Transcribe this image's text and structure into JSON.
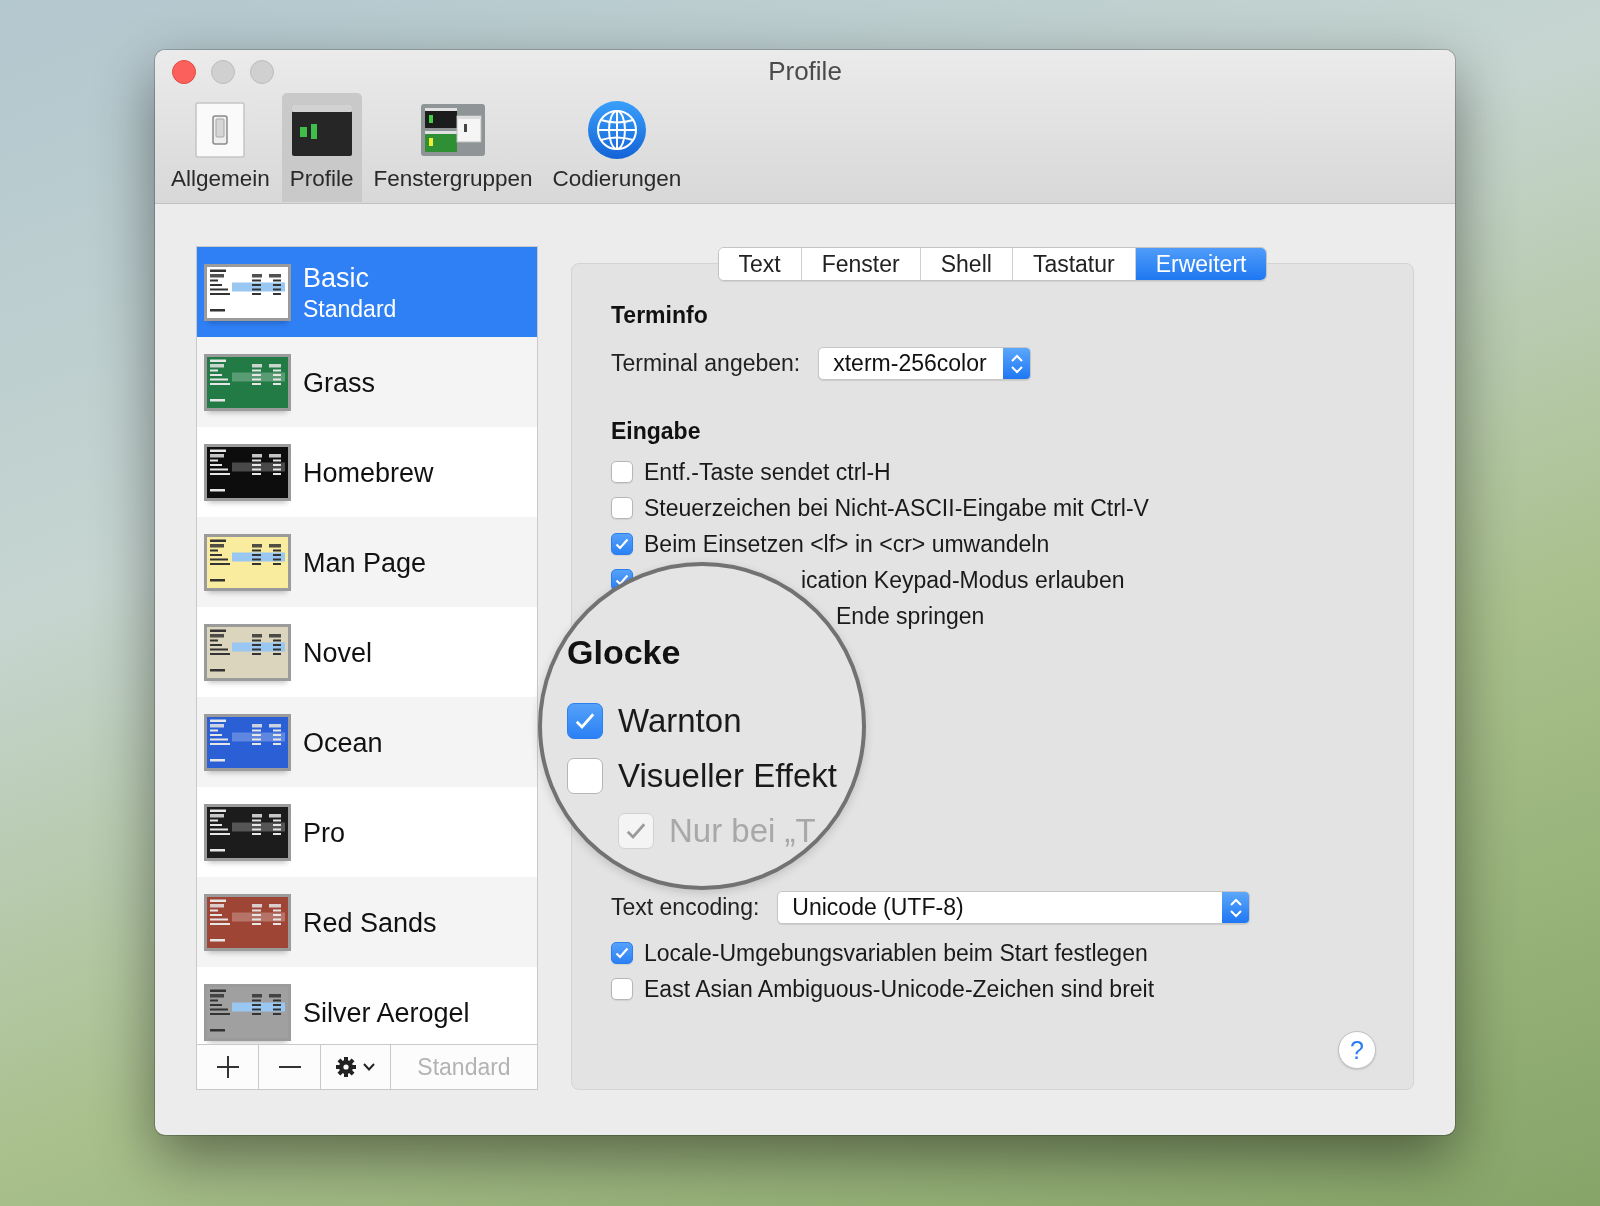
{
  "window": {
    "title": "Profile"
  },
  "toolbar": [
    {
      "label": "Allgemein",
      "kind": "switch",
      "selected": false
    },
    {
      "label": "Profile",
      "kind": "terminal",
      "selected": true
    },
    {
      "label": "Fenstergruppen",
      "kind": "windows",
      "selected": false
    },
    {
      "label": "Codierungen",
      "kind": "globe",
      "selected": false
    }
  ],
  "profiles": [
    {
      "name": "Basic",
      "subtitle": "Standard",
      "selected": true,
      "color": "#ffffff"
    },
    {
      "name": "Grass",
      "selected": false,
      "color": "#227a45"
    },
    {
      "name": "Homebrew",
      "selected": false,
      "color": "#0d0d0d"
    },
    {
      "name": "Man Page",
      "selected": false,
      "color": "#f9ec9f"
    },
    {
      "name": "Novel",
      "selected": false,
      "color": "#dcd5bd"
    },
    {
      "name": "Ocean",
      "selected": false,
      "color": "#2a5fd6"
    },
    {
      "name": "Pro",
      "selected": false,
      "color": "#1c1c1c"
    },
    {
      "name": "Red Sands",
      "selected": false,
      "color": "#9e4536"
    },
    {
      "name": "Silver Aerogel",
      "selected": false,
      "color": "#a0a0a0"
    }
  ],
  "list_footer": {
    "default_button": {
      "label": "Standard",
      "disabled": true
    }
  },
  "tabs": [
    {
      "label": "Text",
      "selected": false
    },
    {
      "label": "Fenster",
      "selected": false
    },
    {
      "label": "Shell",
      "selected": false
    },
    {
      "label": "Tastatur",
      "selected": false
    },
    {
      "label": "Erweitert",
      "selected": true
    }
  ],
  "terminfo": {
    "heading": "Terminfo",
    "label": "Terminal angeben:",
    "value": "xterm-256color"
  },
  "input": {
    "heading": "Eingabe",
    "options": [
      {
        "kind": "checkbox",
        "label": "Entf.-Taste sendet ctrl-H",
        "checked": false
      },
      {
        "kind": "checkbox",
        "label": "Steuerzeichen bei Nicht-ASCII-Eingabe mit Ctrl-V",
        "checked": false
      },
      {
        "kind": "checkbox",
        "label": "Beim Einsetzen <lf> in <cr> umwandeln",
        "checked": true
      },
      {
        "kind": "partial",
        "label": "ication Keypad-Modus erlauben",
        "checked": true
      }
    ],
    "cut_off_text": "Ende springen"
  },
  "magnifier": {
    "heading": "Glocke",
    "options": [
      {
        "label": "Warnton",
        "checked": true,
        "disabled": false
      },
      {
        "label": "Visueller Effekt",
        "checked": false,
        "disabled": false,
        "children": [
          {
            "label": "Nur bei „T",
            "checked": true,
            "disabled": true
          }
        ]
      }
    ]
  },
  "encoding": {
    "label": "Text encoding:",
    "value": "Unicode (UTF-8)",
    "options": [
      {
        "label": "Locale-Umgebungsvariablen beim Start festlegen",
        "checked": true
      },
      {
        "label": "East Asian Ambiguous-Unicode-Zeichen sind breit",
        "checked": false
      }
    ]
  },
  "help_button": {
    "label": "?"
  }
}
